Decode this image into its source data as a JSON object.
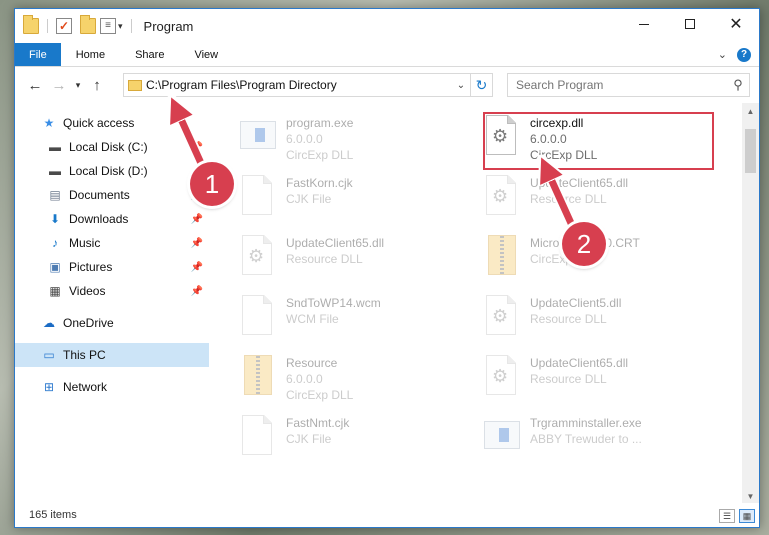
{
  "titlebar": {
    "title": "Program",
    "qat_icons": [
      "folder-icon",
      "checklist-icon",
      "folder-icon",
      "properties-icon"
    ]
  },
  "ribbon": {
    "tabs": [
      "File",
      "Home",
      "Share",
      "View"
    ]
  },
  "address": {
    "path": "C:\\Program Files\\Program Directory"
  },
  "search": {
    "placeholder": "Search Program"
  },
  "nav": {
    "items": [
      {
        "label": "Quick access",
        "icon": "star-icon"
      },
      {
        "label": "Local Disk (C:)",
        "icon": "drive-icon",
        "pinned": true
      },
      {
        "label": "Local Disk (D:)",
        "icon": "drive-icon",
        "pinned": false
      },
      {
        "label": "Documents",
        "icon": "documents-icon",
        "pinned": true
      },
      {
        "label": "Downloads",
        "icon": "download-icon",
        "pinned": true
      },
      {
        "label": "Music",
        "icon": "music-icon",
        "pinned": true
      },
      {
        "label": "Pictures",
        "icon": "pictures-icon",
        "pinned": true
      },
      {
        "label": "Videos",
        "icon": "videos-icon",
        "pinned": true
      },
      {
        "label": "OneDrive",
        "icon": "cloud-icon"
      },
      {
        "label": "This PC",
        "icon": "computer-icon",
        "selected": true
      },
      {
        "label": "Network",
        "icon": "network-icon"
      }
    ]
  },
  "files": [
    {
      "name": "program.exe",
      "line2": "6.0.0.0",
      "line3": "CircExp DLL",
      "icon": "exe-icon",
      "faded": true
    },
    {
      "name": "circexp.dll",
      "line2": "6.0.0.0",
      "line3": "CircExp DLL",
      "icon": "dll-gear-icon",
      "faded": false,
      "highlighted": true
    },
    {
      "name": "FastKorn.cjk",
      "line2": "CJK File",
      "icon": "document-icon",
      "faded": true
    },
    {
      "name": "UpdateClient65.dll",
      "line2": "Resource DLL",
      "icon": "dll-gear-icon",
      "faded": true
    },
    {
      "name": "UpdateClient65.dll",
      "line2": "Resource DLL",
      "icon": "dll-gear-icon",
      "faded": true
    },
    {
      "name": "Microsoft.VC90.CRT",
      "line2": "CircExp DLL",
      "icon": "zip-folder-icon",
      "faded": true
    },
    {
      "name": "SndToWP14.wcm",
      "line2": "WCM File",
      "icon": "document-icon",
      "faded": true
    },
    {
      "name": "UpdateClient5.dll",
      "line2": "Resource DLL",
      "icon": "dll-gear-icon",
      "faded": true
    },
    {
      "name": "Resource",
      "line2": "6.0.0.0",
      "line3": "CircExp DLL",
      "icon": "zip-folder-icon",
      "faded": true
    },
    {
      "name": "UpdateClient65.dll",
      "line2": "Resource DLL",
      "icon": "dll-gear-icon",
      "faded": true
    },
    {
      "name": "FastNmt.cjk",
      "line2": "CJK File",
      "icon": "document-icon",
      "faded": true
    },
    {
      "name": "Trgramminstaller.exe",
      "line2": "ABBY Trewuder to ...",
      "icon": "app-icon",
      "faded": true
    }
  ],
  "status": {
    "item_count": "165 items"
  },
  "annotations": {
    "callout1": "1",
    "callout2": "2",
    "color": "#d73f4f"
  }
}
